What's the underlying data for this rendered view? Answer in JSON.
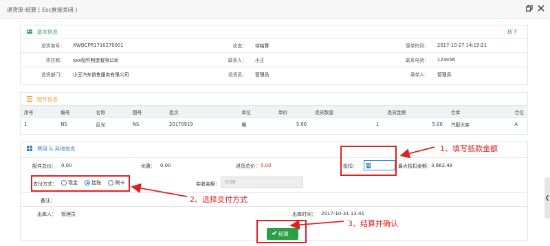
{
  "window": {
    "title": "退货单-结算 ( Esc直接关闭 )",
    "icons": [
      "restore-icon",
      "close-icon"
    ]
  },
  "basic": {
    "section_title": "基本信息",
    "collapse_label": "核下",
    "row1": {
      "doc_no_label": "退货单号：",
      "doc_no": "XWQCPR1710270001",
      "status_label": "状态：",
      "status": "待结算",
      "entry_time_label": "录单时间：",
      "entry_time": "2017-10-27 14:19:21"
    },
    "row2": {
      "supplier_label": "供应商：",
      "supplier": "xxx配件制造有限公司",
      "contact_label": "联系人：",
      "contact": "小王",
      "phone_label": "联系电话：",
      "phone": "123456"
    },
    "row3": {
      "dept_label": "退货部门：",
      "dept": "小王汽车销售服务有限公司",
      "returner_label": "退货员：",
      "returner": "管理员",
      "recorder_label": "录单人：",
      "recorder": "管理员"
    }
  },
  "parts": {
    "section_title": "配件信息",
    "headers": [
      "序号",
      "编号",
      "名称",
      "图号",
      "批次",
      "单位",
      "单价",
      "退货数量",
      "退货金额",
      "仓库",
      "仓位"
    ],
    "rows": [
      [
        "1",
        "NS",
        "反光",
        "NS",
        "20170919",
        "桶",
        "5.00",
        "1",
        "5.00",
        "汽配大库",
        "A"
      ]
    ]
  },
  "fees": {
    "section_title": "费用 & 其他信息",
    "parts_total_label": "配件总价：",
    "parts_total": "0.00",
    "discount_label": "优惠：",
    "discount": "0.00",
    "return_total_label": "退货总价：",
    "return_total": "5.00",
    "deduction_label": "抵扣：",
    "deduction_value": "0",
    "max_deduction_label": "最大抵扣金额：",
    "max_deduction": "3,862.48",
    "pay_method_label": "支付方式：",
    "pay_options": [
      "现金",
      "挂账",
      "刷卡"
    ],
    "pay_selected": "挂账",
    "actual_amount_label": "实收金额：",
    "actual_amount_placeholder": "0.00",
    "remark_label": "备注：",
    "out_person_label": "出库人：",
    "out_person": "管理员",
    "out_time_label": "出库时间：",
    "out_time": "2017-10-31 13:41",
    "settle_button": "结算"
  },
  "annotations": {
    "a1": "1、填写抵款金额",
    "a2": "2、选择支付方式",
    "a3": "3、结算并确认"
  },
  "colors": {
    "green": "#3fa552",
    "blue": "#3a82c4",
    "orange": "#e8a23b",
    "red_annotation": "#e02020",
    "settle_button": "#2e9e44"
  }
}
